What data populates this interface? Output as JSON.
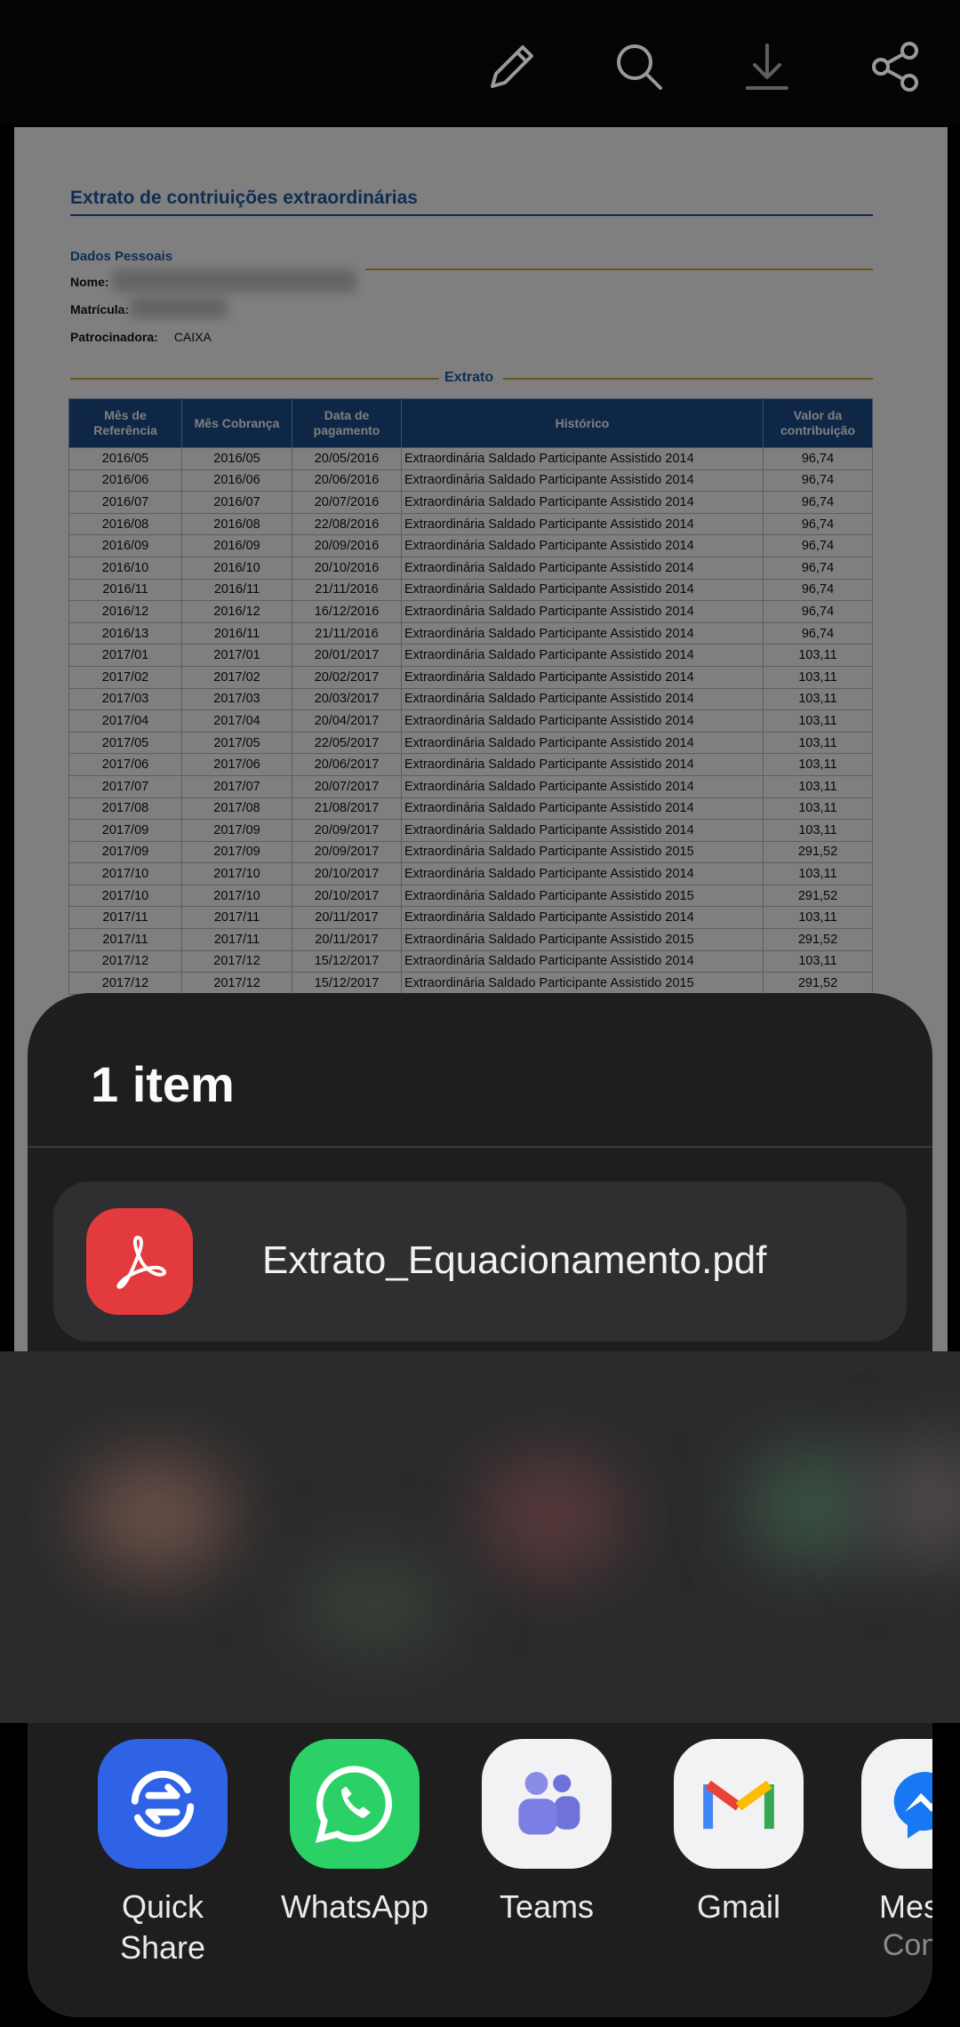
{
  "toolbar": {
    "icons": [
      "edit-icon",
      "search-icon",
      "download-icon",
      "share-icon"
    ]
  },
  "document": {
    "title": "Extrato de contriuições extraordinárias",
    "section": "Dados Pessoais",
    "fields": [
      {
        "label": "Nome:",
        "value": ""
      },
      {
        "label": "Matrícula:",
        "value": ""
      },
      {
        "label": "Patrocinadora:",
        "value": "CAIXA"
      }
    ],
    "extract_label": "Extrato",
    "headers": [
      "Mês de Referência",
      "Mês Cobrança",
      "Data de pagamento",
      "Histórico",
      "Valor da contribuição"
    ],
    "rows": [
      [
        "2016/05",
        "2016/05",
        "20/05/2016",
        "Extraordinária Saldado Participante Assistido 2014",
        "96,74"
      ],
      [
        "2016/06",
        "2016/06",
        "20/06/2016",
        "Extraordinária Saldado Participante Assistido 2014",
        "96,74"
      ],
      [
        "2016/07",
        "2016/07",
        "20/07/2016",
        "Extraordinária Saldado Participante Assistido 2014",
        "96,74"
      ],
      [
        "2016/08",
        "2016/08",
        "22/08/2016",
        "Extraordinária Saldado Participante Assistido 2014",
        "96,74"
      ],
      [
        "2016/09",
        "2016/09",
        "20/09/2016",
        "Extraordinária Saldado Participante Assistido 2014",
        "96,74"
      ],
      [
        "2016/10",
        "2016/10",
        "20/10/2016",
        "Extraordinária Saldado Participante Assistido 2014",
        "96,74"
      ],
      [
        "2016/11",
        "2016/11",
        "21/11/2016",
        "Extraordinária Saldado Participante Assistido 2014",
        "96,74"
      ],
      [
        "2016/12",
        "2016/12",
        "16/12/2016",
        "Extraordinária Saldado Participante Assistido 2014",
        "96,74"
      ],
      [
        "2016/13",
        "2016/11",
        "21/11/2016",
        "Extraordinária Saldado Participante Assistido 2014",
        "96,74"
      ],
      [
        "2017/01",
        "2017/01",
        "20/01/2017",
        "Extraordinária Saldado Participante Assistido 2014",
        "103,11"
      ],
      [
        "2017/02",
        "2017/02",
        "20/02/2017",
        "Extraordinária Saldado Participante Assistido 2014",
        "103,11"
      ],
      [
        "2017/03",
        "2017/03",
        "20/03/2017",
        "Extraordinária Saldado Participante Assistido 2014",
        "103,11"
      ],
      [
        "2017/04",
        "2017/04",
        "20/04/2017",
        "Extraordinária Saldado Participante Assistido 2014",
        "103,11"
      ],
      [
        "2017/05",
        "2017/05",
        "22/05/2017",
        "Extraordinária Saldado Participante Assistido 2014",
        "103,11"
      ],
      [
        "2017/06",
        "2017/06",
        "20/06/2017",
        "Extraordinária Saldado Participante Assistido 2014",
        "103,11"
      ],
      [
        "2017/07",
        "2017/07",
        "20/07/2017",
        "Extraordinária Saldado Participante Assistido 2014",
        "103,11"
      ],
      [
        "2017/08",
        "2017/08",
        "21/08/2017",
        "Extraordinária Saldado Participante Assistido 2014",
        "103,11"
      ],
      [
        "2017/09",
        "2017/09",
        "20/09/2017",
        "Extraordinária Saldado Participante Assistido 2014",
        "103,11"
      ],
      [
        "2017/09",
        "2017/09",
        "20/09/2017",
        "Extraordinária Saldado Participante Assistido 2015",
        "291,52"
      ],
      [
        "2017/10",
        "2017/10",
        "20/10/2017",
        "Extraordinária Saldado Participante Assistido 2014",
        "103,11"
      ],
      [
        "2017/10",
        "2017/10",
        "20/10/2017",
        "Extraordinária Saldado Participante Assistido 2015",
        "291,52"
      ],
      [
        "2017/11",
        "2017/11",
        "20/11/2017",
        "Extraordinária Saldado Participante Assistido 2014",
        "103,11"
      ],
      [
        "2017/11",
        "2017/11",
        "20/11/2017",
        "Extraordinária Saldado Participante Assistido 2015",
        "291,52"
      ],
      [
        "2017/12",
        "2017/12",
        "15/12/2017",
        "Extraordinária Saldado Participante Assistido 2014",
        "103,11"
      ],
      [
        "2017/12",
        "2017/12",
        "15/12/2017",
        "Extraordinária Saldado Participante Assistido 2015",
        "291,52"
      ]
    ]
  },
  "share_sheet": {
    "title": "1 item",
    "file_name": "Extrato_Equacionamento.pdf",
    "apps": [
      {
        "label": "Quick Share",
        "color": "#2f63e6",
        "icon": "quick-share-icon"
      },
      {
        "label": "WhatsApp",
        "color": "#2bd166",
        "icon": "whatsapp-icon"
      },
      {
        "label": "Teams",
        "color": "#f2f2f4",
        "icon": "teams-icon"
      },
      {
        "label": "Gmail",
        "color": "#f2f2f4",
        "icon": "gmail-icon"
      },
      {
        "label": "Messe",
        "sub": "Conve",
        "color": "#f2f2f4",
        "icon": "messenger-icon"
      }
    ]
  }
}
